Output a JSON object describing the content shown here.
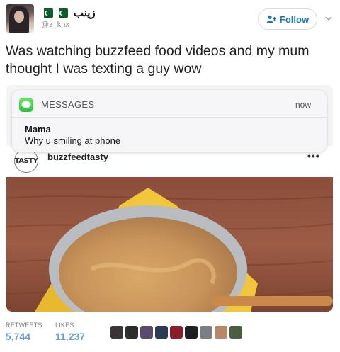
{
  "tweet": {
    "display_name": "زینب",
    "handle": "@z_khx",
    "follow_label": "Follow",
    "text": "Was watching buzzfeed food videos and my mum thought I was texting a guy wow",
    "retweets_label": "RETWEETS",
    "retweets_count": "5,744",
    "likes_label": "LIKES",
    "likes_count": "11,237"
  },
  "notification": {
    "app": "MESSAGES",
    "time": "now",
    "sender": "Mama",
    "body": "Why u smiling at phone"
  },
  "embedded_post": {
    "logo_text": "TASTY",
    "account": "buzzfeedtasty",
    "more": "•••"
  },
  "icons": {
    "flag": "pakistan-flag-icon",
    "follow": "add-user-icon",
    "caret": "chevron-down-icon",
    "app": "messages-bubble-icon",
    "more": "ellipsis-icon"
  },
  "colors": {
    "follow_text": "#1b75bb",
    "stat_value": "#6b9fd0",
    "messages_green": "#28c43b"
  },
  "liker_avatars": [
    {
      "color": "#3b3432"
    },
    {
      "color": "#2e2b30"
    },
    {
      "color": "#5b4a6e"
    },
    {
      "color": "#2c3a55"
    },
    {
      "color": "#8c1c2b"
    },
    {
      "color": "#1f1f22"
    },
    {
      "color": "#7a7f86"
    },
    {
      "color": "#b7876a"
    },
    {
      "color": "#4b5d3f"
    }
  ]
}
